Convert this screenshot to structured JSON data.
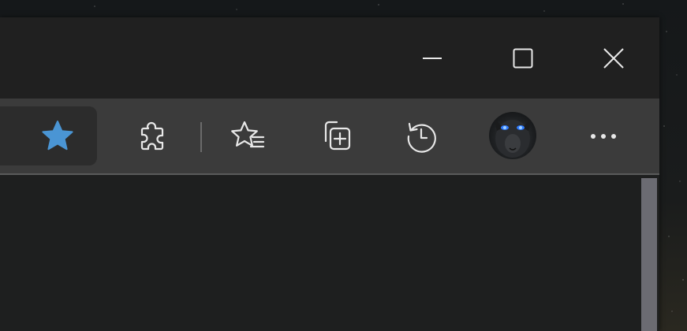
{
  "titlebar": {
    "minimize_icon": "minimize-icon",
    "maximize_icon": "maximize-icon",
    "close_icon": "close-icon"
  },
  "toolbar": {
    "favorite_icon": "filled-star-icon",
    "extensions_icon": "puzzle-piece-icon",
    "favorites_icon": "star-list-icon",
    "collections_icon": "collections-icon",
    "history_icon": "history-icon",
    "profile_icon": "profile-avatar",
    "menu_icon": "ellipsis-icon"
  },
  "colors": {
    "accent_star": "#4a95d4",
    "icon_stroke": "#e8e8e8",
    "titlebar_bg": "#202020",
    "toolbar_bg": "#3b3b3b",
    "content_bg": "#1e1f1f",
    "scrollbar": "#6b6b72",
    "avatar_eye": "#2f7bff"
  }
}
